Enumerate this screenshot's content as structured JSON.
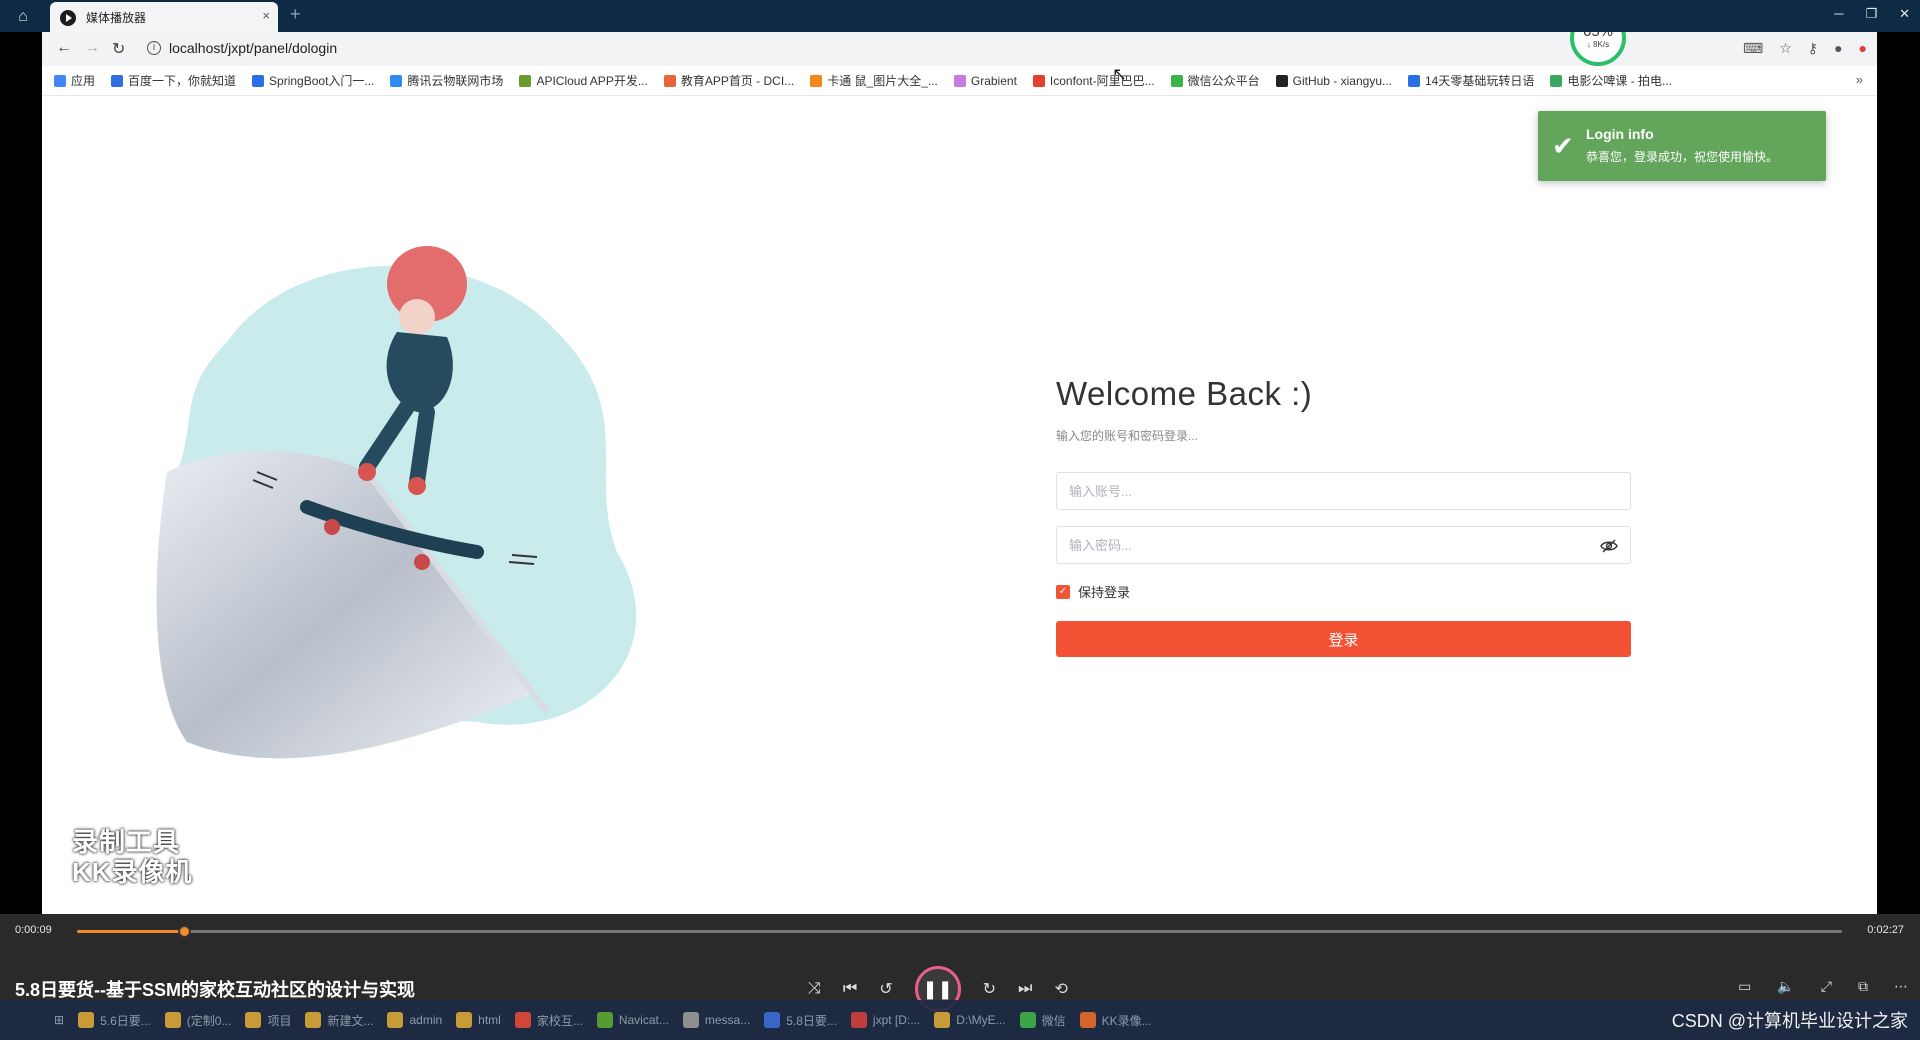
{
  "player": {
    "tab_title": "媒体播放器",
    "tab_close": "×",
    "new_tab": "+",
    "current_time": "0:00:09",
    "total_time": "0:02:27",
    "progress": 0.061,
    "video_title": "5.8日要货--基于SSM的家校互动社区的设计与实现",
    "watermark_line1": "录制工具",
    "watermark_line2": "KK录像机",
    "csdn_credit": "CSDN @计算机毕业设计之家"
  },
  "browser": {
    "url": "localhost/jxpt/panel/dologin",
    "speed_percent": "65%",
    "speed_rate": "↓ 8K/s",
    "bookmarks": [
      {
        "label": "应用",
        "color": "#4285f4"
      },
      {
        "label": "百度一下，你就知道",
        "color": "#2f6de1"
      },
      {
        "label": "SpringBoot入门一...",
        "color": "#2a6fe3"
      },
      {
        "label": "腾讯云物联网市场",
        "color": "#2d8cf0"
      },
      {
        "label": "APICloud APP开发...",
        "color": "#6a9c2d"
      },
      {
        "label": "教育APP首页 - DCI...",
        "color": "#e8643a"
      },
      {
        "label": "卡通 鼠_图片大全_...",
        "color": "#f08a1c"
      },
      {
        "label": "Grabient",
        "color": "#c77de0"
      },
      {
        "label": "Iconfont-阿里巴巴...",
        "color": "#e5402f"
      },
      {
        "label": "微信公众平台",
        "color": "#3bb34a"
      },
      {
        "label": "GitHub - xiangyu...",
        "color": "#222222"
      },
      {
        "label": "14天零基础玩转日语",
        "color": "#2a6fe3"
      },
      {
        "label": "电影公啤课 - 拍电...",
        "color": "#3aa660"
      }
    ],
    "bookmarks_more": "»"
  },
  "login": {
    "welcome": "Welcome Back :)",
    "subtitle": "输入您的账号和密码登录...",
    "username_placeholder": "输入账号...",
    "password_placeholder": "输入密码...",
    "remember_label": "保持登录",
    "remember_checked": true,
    "submit_label": "登录"
  },
  "toast": {
    "title": "Login info",
    "message": "恭喜您，登录成功，祝您使用愉快。"
  },
  "taskbar": {
    "items": [
      {
        "label": "5.6日要...",
        "color": "#d8a83a"
      },
      {
        "label": "(定制0...",
        "color": "#d8a83a"
      },
      {
        "label": "项目",
        "color": "#d8a83a"
      },
      {
        "label": "新建文...",
        "color": "#d8a83a"
      },
      {
        "label": "admin",
        "color": "#d8a83a"
      },
      {
        "label": "html",
        "color": "#d8a83a"
      },
      {
        "label": "家校互...",
        "color": "#e24a3b"
      },
      {
        "label": "Navicat...",
        "color": "#5aa832"
      },
      {
        "label": "messa...",
        "color": "#9a9a9a"
      },
      {
        "label": "5.8日要...",
        "color": "#3a6fd8"
      },
      {
        "label": "jxpt [D:...",
        "color": "#d04040"
      },
      {
        "label": "D:\\MyE...",
        "color": "#d8a83a"
      },
      {
        "label": "微信",
        "color": "#3bb34a"
      },
      {
        "label": "KK录像...",
        "color": "#e86b2a"
      }
    ]
  },
  "colors": {
    "accent": "#f25233",
    "toast": "#63a55b",
    "progress": "#f08a2a"
  }
}
